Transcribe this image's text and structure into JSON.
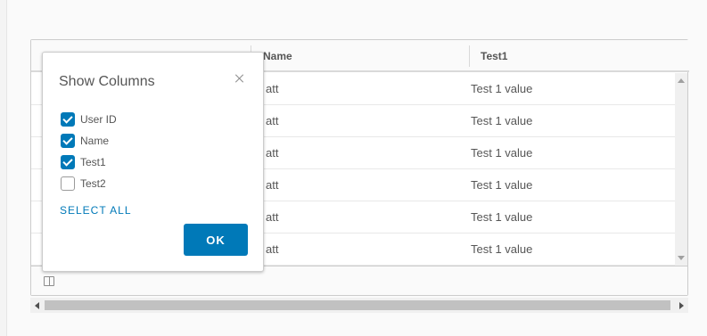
{
  "grid": {
    "columns": [
      "Name",
      "Test1"
    ],
    "rows": [
      [
        "att",
        "Test 1 value"
      ],
      [
        "att",
        "Test 1 value"
      ],
      [
        "att",
        "Test 1 value"
      ],
      [
        "att",
        "Test 1 value"
      ],
      [
        "att",
        "Test 1 value"
      ],
      [
        "att",
        "Test 1 value"
      ]
    ]
  },
  "column_popover": {
    "title": "Show Columns",
    "options": [
      {
        "label": "User ID",
        "checked": true
      },
      {
        "label": "Name",
        "checked": true
      },
      {
        "label": "Test1",
        "checked": true
      },
      {
        "label": "Test2",
        "checked": false
      }
    ],
    "select_all_label": "SELECT ALL",
    "ok_label": "OK"
  },
  "icons": {
    "close": "close-icon",
    "column_toggle": "columns-icon",
    "scroll_up": "scroll-up-arrow-icon",
    "scroll_down": "scroll-down-arrow-icon",
    "scroll_left": "scroll-left-arrow-icon",
    "scroll_right": "scroll-right-arrow-icon"
  },
  "colors": {
    "accent": "#0079b8",
    "text": "#565656",
    "border": "#cccccc"
  }
}
